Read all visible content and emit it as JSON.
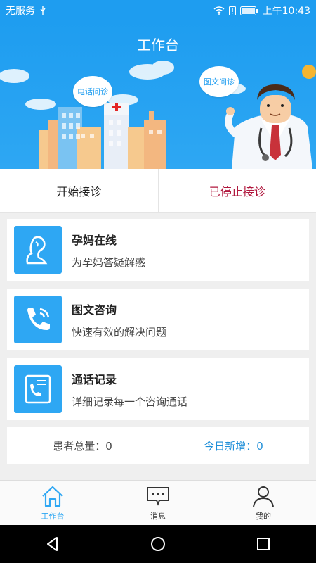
{
  "status_bar": {
    "carrier": "无服务",
    "time": "上午10:43"
  },
  "header": {
    "title": "工作台",
    "bubble_phone": "电话问诊",
    "bubble_text": "图文问诊"
  },
  "consult_switch": {
    "start_label": "开始接诊",
    "stop_label": "已停止接诊"
  },
  "cards": [
    {
      "title": "孕妈在线",
      "subtitle": "为孕妈答疑解惑",
      "icon": "pregnant-woman-icon"
    },
    {
      "title": "图文咨询",
      "subtitle": "快速有效的解决问题",
      "icon": "phone-icon"
    },
    {
      "title": "通话记录",
      "subtitle": "详细记录每一个咨询通话",
      "icon": "call-record-icon"
    }
  ],
  "stats": {
    "total_label": "患者总量：0",
    "today_label": "今日新增：0"
  },
  "tabs": [
    {
      "label": "工作台",
      "icon": "home-icon",
      "active": true
    },
    {
      "label": "消息",
      "icon": "message-icon",
      "active": false
    },
    {
      "label": "我的",
      "icon": "user-icon",
      "active": false
    }
  ],
  "colors": {
    "primary": "#2ea7f3",
    "stop_red": "#b0163c"
  }
}
